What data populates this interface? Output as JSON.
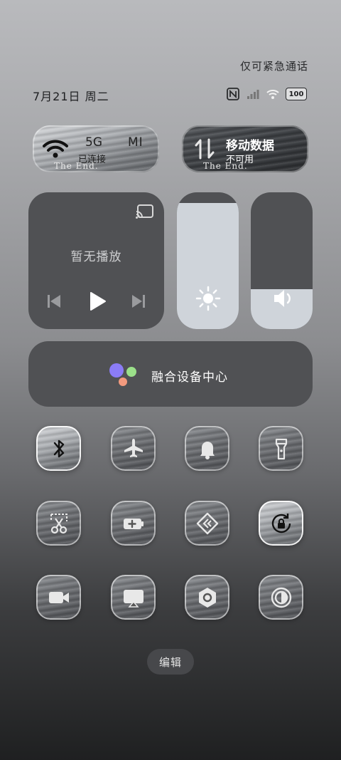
{
  "status": {
    "emergency_text": "仅可紧急通话",
    "date_text": "7月21日 周二",
    "battery": "100",
    "icons": [
      "nfc-icon",
      "signal-icon",
      "wifi-icon",
      "battery-icon"
    ]
  },
  "wifi_tile": {
    "title": "5G",
    "brand": "MI",
    "subtitle": "已连接",
    "overlay": "The End."
  },
  "data_tile": {
    "title": "移动数据",
    "subtitle": "不可用",
    "overlay": "The End."
  },
  "media": {
    "status": "暂无播放"
  },
  "sliders": {
    "brightness_level": 0.92,
    "volume_level": 0.29
  },
  "hub": {
    "label": "融合设备中心",
    "dot_colors": [
      "#8b7cf6",
      "#9be08a",
      "#f39a7e"
    ]
  },
  "toggles": [
    {
      "name": "bluetooth",
      "icon": "bluetooth-icon",
      "active": true
    },
    {
      "name": "airplane-mode",
      "icon": "airplane-icon",
      "active": false
    },
    {
      "name": "do-not-disturb",
      "icon": "bell-icon",
      "active": false
    },
    {
      "name": "flashlight",
      "icon": "flashlight-icon",
      "active": false
    },
    {
      "name": "screenshot",
      "icon": "scissors-icon",
      "active": false
    },
    {
      "name": "battery-saver",
      "icon": "battery-plus-icon",
      "active": false
    },
    {
      "name": "nearby-share",
      "icon": "share-icon",
      "active": false
    },
    {
      "name": "rotation-lock",
      "icon": "rotation-lock-icon",
      "active": true
    },
    {
      "name": "screen-record",
      "icon": "video-icon",
      "active": false
    },
    {
      "name": "screen-cast",
      "icon": "cast-screen-icon",
      "active": false
    },
    {
      "name": "settings",
      "icon": "hexagon-settings-icon",
      "active": false
    },
    {
      "name": "dark-mode",
      "icon": "contrast-icon",
      "active": false
    }
  ],
  "edit_label": "编辑"
}
